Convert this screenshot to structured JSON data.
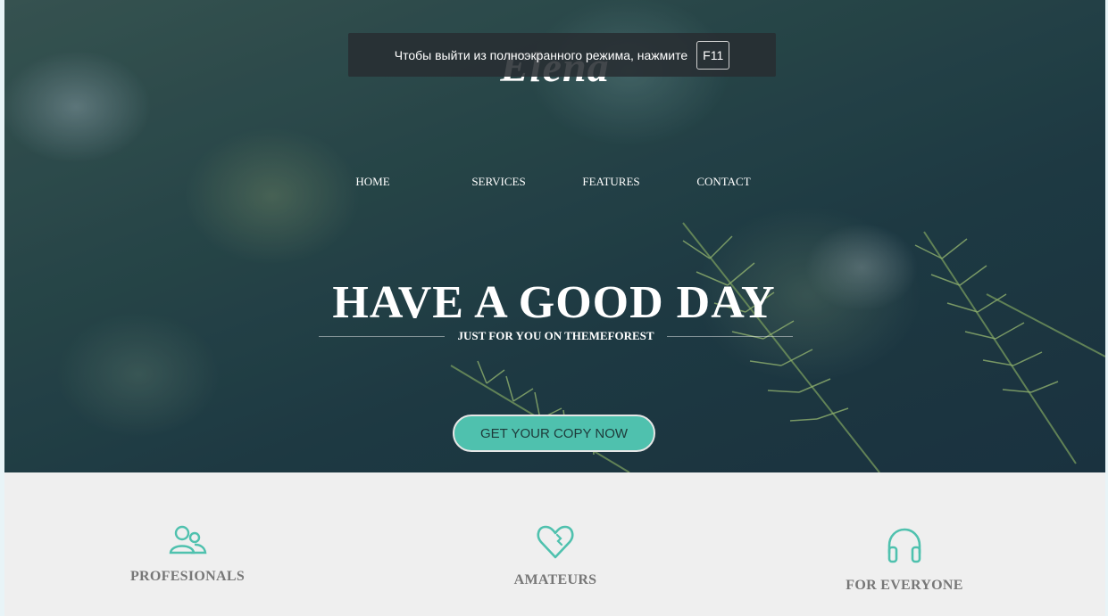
{
  "fullscreen_notice": {
    "text": "Чтобы выйти из полноэкранного режима, нажмите",
    "key": "F11"
  },
  "hero": {
    "logo": "Elena",
    "nav": [
      "HOME",
      "SERVICES",
      "FEATURES",
      "CONTACT"
    ],
    "headline": "HAVE A GOOD DAY",
    "subline": "JUST FOR YOU ON THEMEFOREST",
    "cta_label": "GET YOUR COPY NOW"
  },
  "features": [
    {
      "title": "PROFESIONALS",
      "icon": "users-icon"
    },
    {
      "title": "AMATEURS",
      "icon": "heart-icon"
    },
    {
      "title": "FOR EVERYONE",
      "icon": "headphones-icon"
    }
  ],
  "colors": {
    "accent": "#4fc1ae",
    "feature_bg": "#efefef",
    "feature_title": "#777777"
  }
}
